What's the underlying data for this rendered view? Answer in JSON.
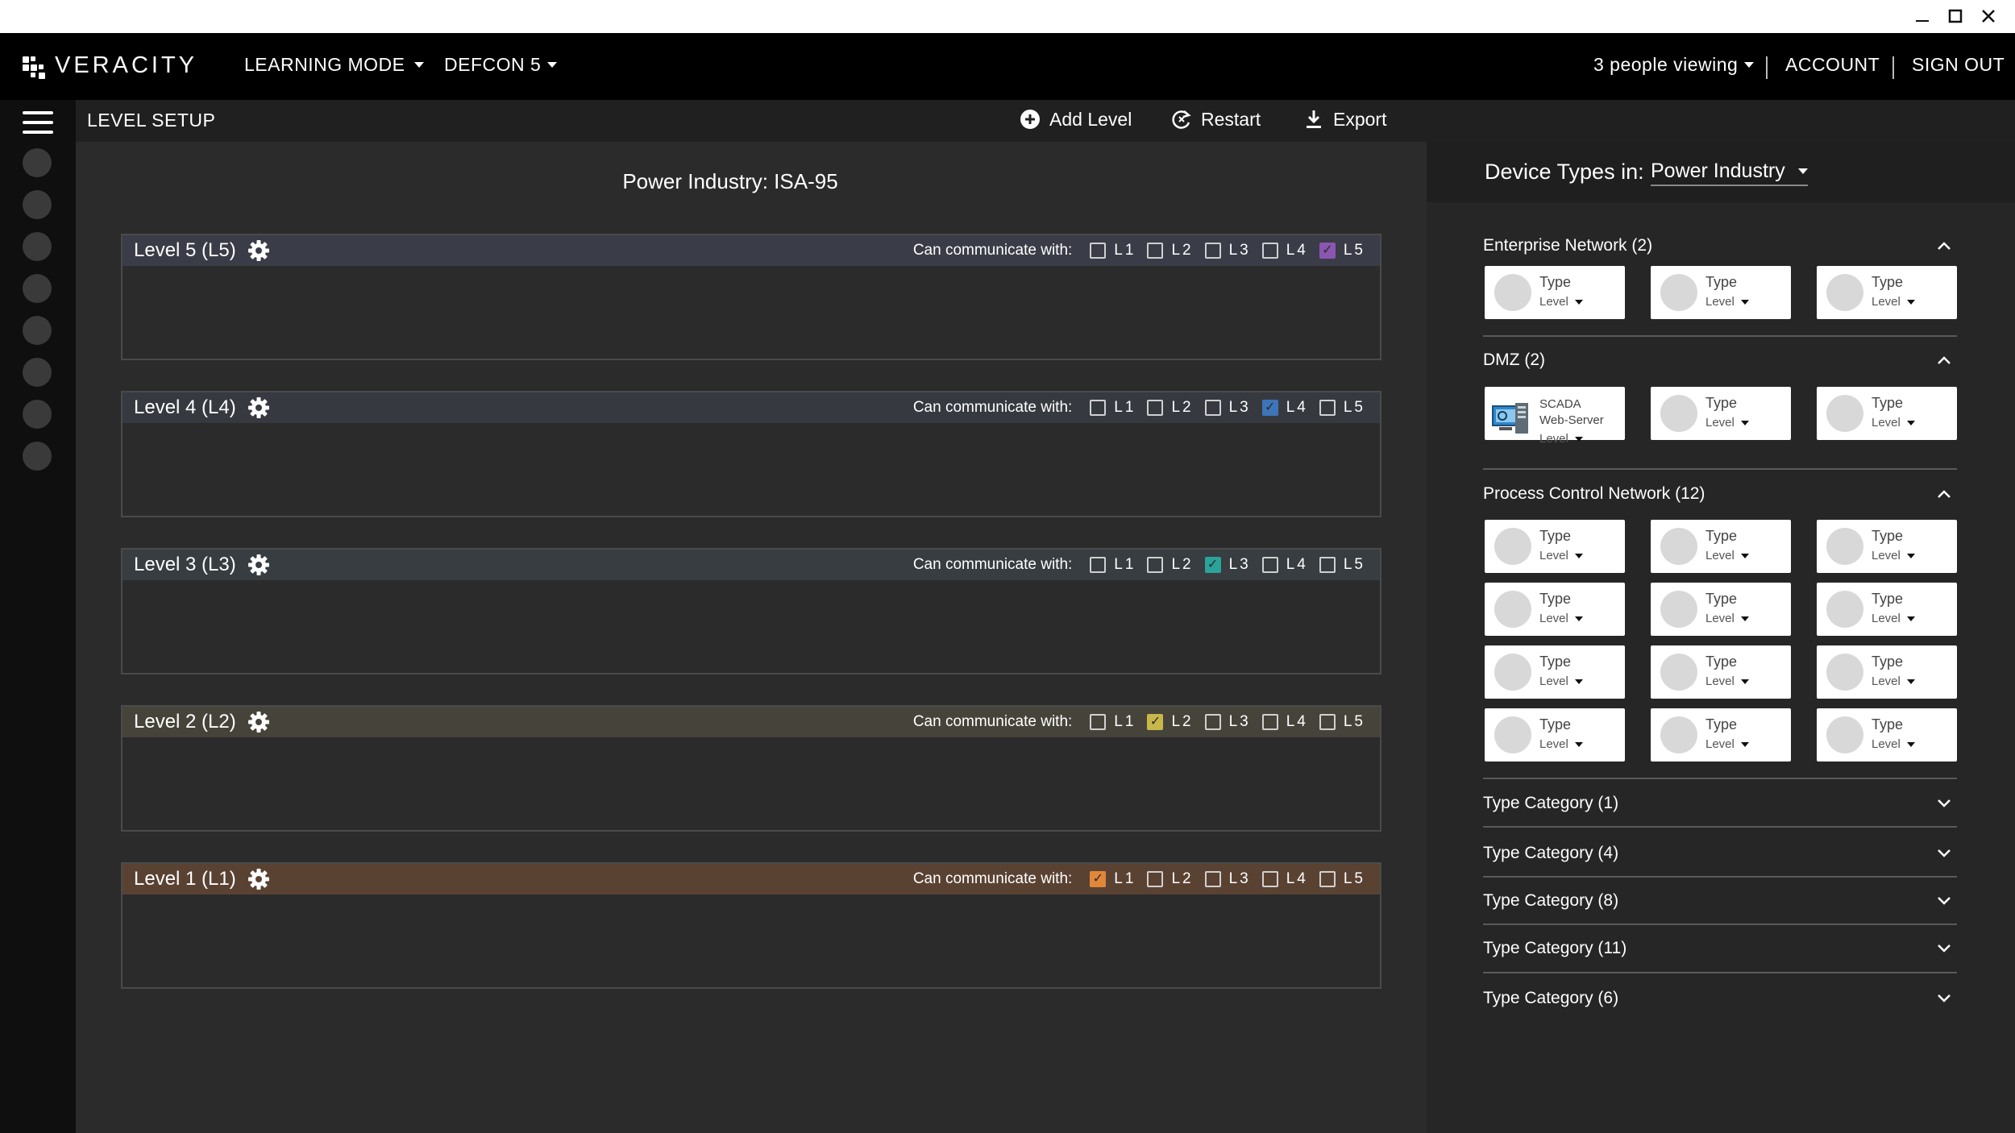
{
  "window": {
    "minimize_icon": "minimize-icon",
    "maximize_icon": "maximize-icon",
    "close_icon": "close-icon"
  },
  "brand": {
    "name": "VERACITY"
  },
  "nav": {
    "learning_mode": "LEARNING MODE",
    "defcon": "DEFCON 5",
    "viewers": "3 people viewing",
    "account": "ACCOUNT",
    "sign_out": "SIGN OUT"
  },
  "subheader": {
    "title": "LEVEL SETUP",
    "add_level": "Add Level",
    "restart": "Restart",
    "export": "Export"
  },
  "main": {
    "title": "Power Industry: ISA-95",
    "comm_label": "Can communicate with:",
    "levels": [
      {
        "name": "Level 5 (L5)",
        "color": "#3a3c47",
        "checked": [
          false,
          false,
          false,
          false,
          true
        ],
        "check_color": "#8a56b0"
      },
      {
        "name": "Level 4 (L4)",
        "color": "#363a40",
        "checked": [
          false,
          false,
          false,
          true,
          false
        ],
        "check_color": "#3d75b8"
      },
      {
        "name": "Level 3 (L3)",
        "color": "#373d40",
        "checked": [
          false,
          false,
          true,
          false,
          false
        ],
        "check_color": "#2aa39b"
      },
      {
        "name": "Level 2 (L2)",
        "color": "#46443a",
        "checked": [
          false,
          true,
          false,
          false,
          false
        ],
        "check_color": "#c8b84a"
      },
      {
        "name": "Level 1 (L1)",
        "color": "#5a4233",
        "checked": [
          true,
          false,
          false,
          false,
          false
        ],
        "check_color": "#e0873a"
      }
    ],
    "checkbox_labels": [
      "L1",
      "L2",
      "L3",
      "L4",
      "L5"
    ]
  },
  "side": {
    "label": "Device Types in:",
    "selected": "Power Industry",
    "sections": [
      {
        "title": "Enterprise Network (2)",
        "expanded": true
      },
      {
        "title": "DMZ (2)",
        "expanded": true
      },
      {
        "title": "Process Control Network (12)",
        "expanded": true
      },
      {
        "title": "Type Category (1)",
        "expanded": false
      },
      {
        "title": "Type Category (4)",
        "expanded": false
      },
      {
        "title": "Type Category (8)",
        "expanded": false
      },
      {
        "title": "Type Category (11)",
        "expanded": false
      },
      {
        "title": "Type Category (6)",
        "expanded": false
      }
    ],
    "card": {
      "type": "Type",
      "level": "Level"
    },
    "scada": {
      "line1": "SCADA",
      "line2": "Web-Server",
      "level": "Level"
    }
  }
}
